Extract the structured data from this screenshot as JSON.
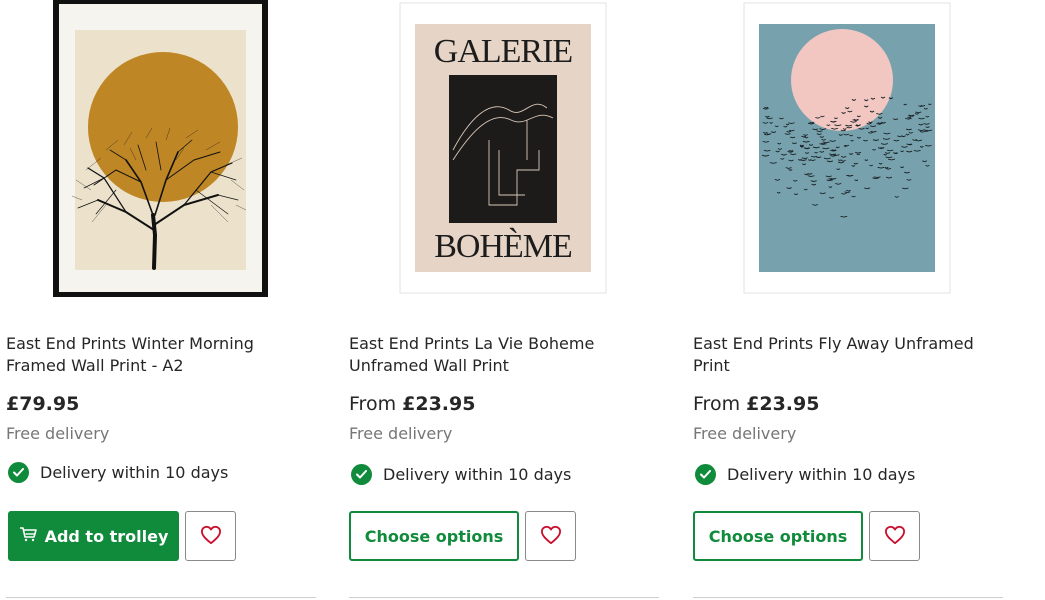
{
  "products": [
    {
      "title": "East End Prints Winter Morning Framed Wall Print - A2",
      "price_prefix": "",
      "price": "£79.95",
      "delivery_note": "Free delivery",
      "delivery_within": "Delivery within 10 days",
      "button_label": "Add to trolley",
      "button_icon": "trolley-icon",
      "wishlist_icon": "heart-icon"
    },
    {
      "title": "East End Prints La Vie Boheme Unframed Wall Print",
      "price_prefix": "From",
      "price": "£23.95",
      "delivery_note": "Free delivery",
      "delivery_within": "Delivery within 10 days",
      "button_label": "Choose options",
      "wishlist_icon": "heart-icon",
      "art_text_top": "GALERIE",
      "art_text_bottom": "BOHÈME"
    },
    {
      "title": "East End Prints Fly Away Unframed Print",
      "price_prefix": "From",
      "price": "£23.95",
      "delivery_note": "Free delivery",
      "delivery_within": "Delivery within 10 days",
      "button_label": "Choose options",
      "wishlist_icon": "heart-icon"
    }
  ],
  "colors": {
    "brand_green": "#108a3b",
    "heart_red": "#c8102e",
    "muted_text": "#767676"
  }
}
